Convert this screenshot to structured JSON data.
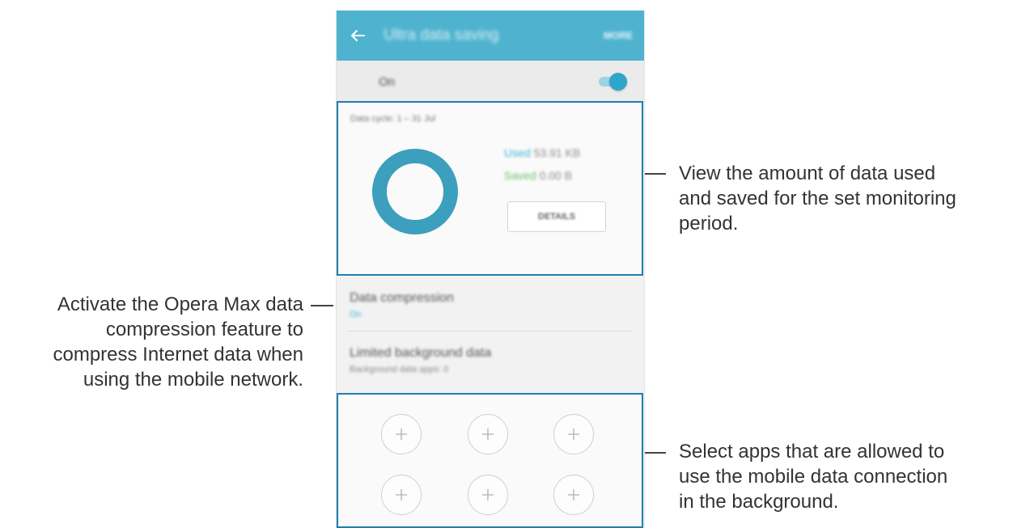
{
  "app_bar": {
    "back_icon": "arrow-left-icon",
    "title": "Ultra data saving",
    "more_label": "MORE",
    "color": "#4fb3cf"
  },
  "master_switch": {
    "label": "On",
    "state": "on",
    "accent_color": "#2ea6c9"
  },
  "usage": {
    "cycle_text": "Data cycle: 1 – 31 Jul",
    "used_label": "Used",
    "used_value": "53.91 KB",
    "saved_label": "Saved",
    "saved_value": "0.00 B",
    "details_button": "DETAILS",
    "used_color": "#3fb4d5",
    "saved_color": "#6cc06f"
  },
  "settings": [
    {
      "title": "Data compression",
      "subtitle": "On"
    },
    {
      "title": "Limited background data",
      "subtitle": "Background data apps: 0"
    }
  ],
  "app_slots": [
    {
      "icon": "plus-icon"
    },
    {
      "icon": "plus-icon"
    },
    {
      "icon": "plus-icon"
    },
    {
      "icon": "plus-icon"
    },
    {
      "icon": "plus-icon"
    },
    {
      "icon": "plus-icon"
    }
  ],
  "callouts": {
    "usage": [
      "View the amount of data used",
      "and saved for the set monitoring",
      "period."
    ],
    "compression": [
      "Activate the Opera Max data",
      "compression feature to",
      "compress Internet data when",
      "using the mobile network."
    ],
    "apps": [
      "Select apps that are allowed to",
      "use the mobile data connection",
      "in the background."
    ],
    "highlight_color": "#1f7fae"
  }
}
